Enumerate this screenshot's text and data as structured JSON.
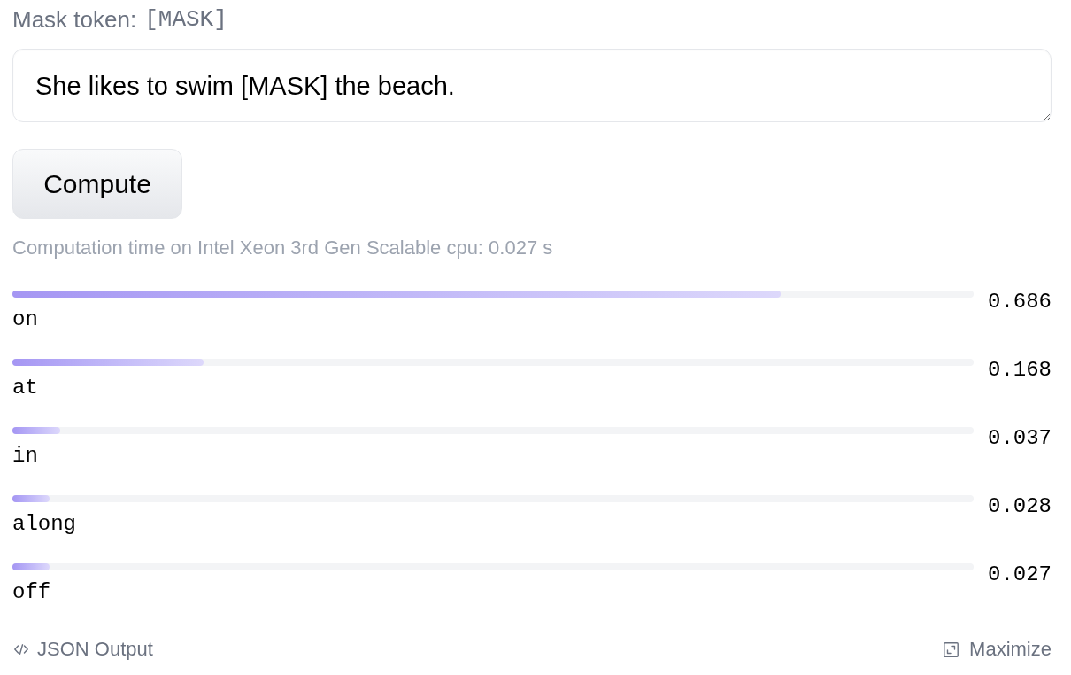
{
  "mask_token": {
    "label": "Mask token:",
    "token": "[MASK]"
  },
  "input": {
    "value": "She likes to swim [MASK] the beach."
  },
  "compute_button": {
    "label": "Compute"
  },
  "computation_time": "Computation time on Intel Xeon 3rd Gen Scalable cpu: 0.027 s",
  "predictions": [
    {
      "label": "on",
      "score": "0.686",
      "level": 0.799
    },
    {
      "label": "at",
      "score": "0.168",
      "level": 0.199
    },
    {
      "label": "in",
      "score": "0.037",
      "level": 0.05
    },
    {
      "label": "along",
      "score": "0.028",
      "level": 0.039
    },
    {
      "label": "off",
      "score": "0.027",
      "level": 0.039
    }
  ],
  "footer": {
    "json_output": "JSON Output",
    "maximize": "Maximize"
  }
}
